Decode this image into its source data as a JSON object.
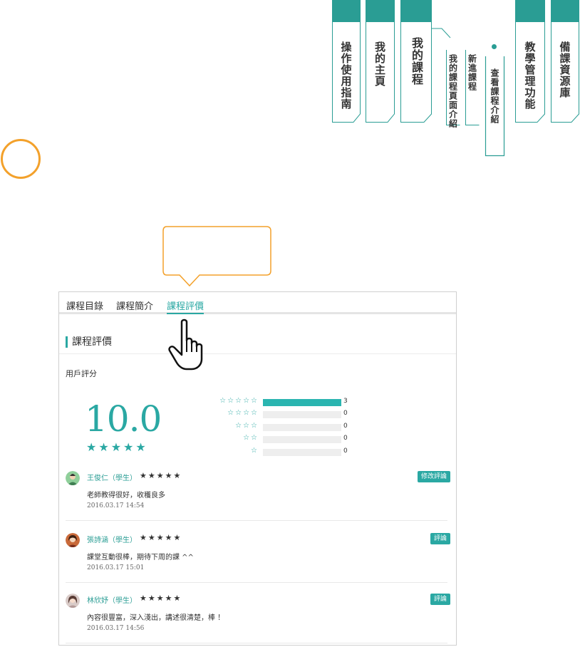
{
  "nav": {
    "tabs": [
      {
        "label": "操作使用指南"
      },
      {
        "label": "我的主頁"
      },
      {
        "label": "我的課程"
      },
      {
        "label": "我的課程頁面介紹"
      },
      {
        "label": "新進課程"
      },
      {
        "label": "查看課程介紹"
      },
      {
        "label": "教學管理功能"
      },
      {
        "label": "備課資源庫"
      }
    ],
    "accent_color": "#2a9d94"
  },
  "callout": {
    "text": ""
  },
  "panel": {
    "tabs": [
      "課程目錄",
      "課程簡介",
      "課程評價"
    ],
    "active_tab": "課程評價",
    "section_title": "課程評價",
    "user_rating_label": "用戶評分",
    "score": "10.0",
    "score_stars": 5,
    "distribution": [
      {
        "stars": 5,
        "count": "3",
        "fraction": 1.0
      },
      {
        "stars": 4,
        "count": "0",
        "fraction": 0
      },
      {
        "stars": 3,
        "count": "0",
        "fraction": 0
      },
      {
        "stars": 2,
        "count": "0",
        "fraction": 0
      },
      {
        "stars": 1,
        "count": "0",
        "fraction": 0
      }
    ],
    "reviews": [
      {
        "name": "王俊仁（學生）",
        "stars": 5,
        "text": "老師教得很好，收穫良多",
        "date": "2016.03.17 14:54",
        "button": "修改評論"
      },
      {
        "name": "張詩涵（學生）",
        "stars": 5,
        "text": "課堂互動很棒，期待下周的課 ^^",
        "date": "2016.03.17 15:01",
        "button": "評論"
      },
      {
        "name": "林欣妤（學生）",
        "stars": 5,
        "text": "內容很豐富，深入淺出，講述很清楚，棒 ！",
        "date": "2016.03.17 14:56",
        "button": "評論"
      }
    ],
    "accent_color": "#2aa8a3"
  },
  "decor": {
    "ring_color": "#f3a12b"
  }
}
